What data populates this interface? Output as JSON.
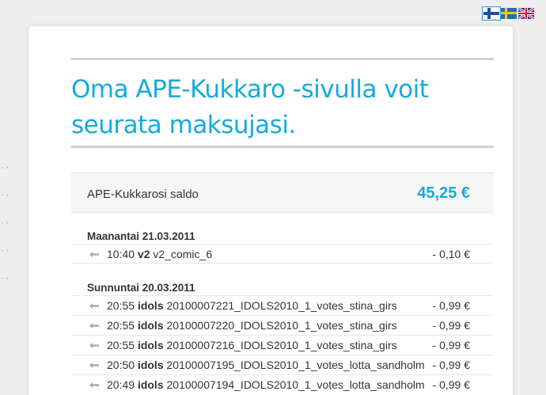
{
  "languages": [
    {
      "code": "fi",
      "icon": "finnish-flag-icon",
      "selected": true
    },
    {
      "code": "sv",
      "icon": "swedish-flag-icon",
      "selected": false
    },
    {
      "code": "en",
      "icon": "british-flag-icon",
      "selected": false
    }
  ],
  "headline": "Oma APE-Kukkaro -sivulla voit seurata maksujasi.",
  "balance": {
    "label": "APE-Kukkarosi saldo",
    "amount": "45,25 €"
  },
  "days": [
    {
      "heading": "Maanantai 21.03.2011",
      "transactions": [
        {
          "time": "10:40",
          "service": "v2",
          "item": "v2_comic_6",
          "amount": "- 0,10 €"
        }
      ]
    },
    {
      "heading": "Sunnuntai 20.03.2011",
      "transactions": [
        {
          "time": "20:55",
          "service": "idols",
          "item": "20100007221_IDOLS2010_1_votes_stina_girs",
          "amount": "- 0,99 €"
        },
        {
          "time": "20:55",
          "service": "idols",
          "item": "20100007220_IDOLS2010_1_votes_stina_girs",
          "amount": "- 0,99 €"
        },
        {
          "time": "20:55",
          "service": "idols",
          "item": "20100007216_IDOLS2010_1_votes_stina_girs",
          "amount": "- 0,99 €"
        },
        {
          "time": "20:50",
          "service": "idols",
          "item": "20100007195_IDOLS2010_1_votes_lotta_sandholm",
          "amount": "- 0,99 €"
        },
        {
          "time": "20:49",
          "service": "idols",
          "item": "20100007194_IDOLS2010_1_votes_lotta_sandholm",
          "amount": "- 0,99 €"
        }
      ]
    }
  ],
  "icons": {
    "transaction": "arrow-left-icon"
  },
  "colors": {
    "accent": "#18a9dc",
    "text": "#333333",
    "rule": "#d2d2d2"
  }
}
